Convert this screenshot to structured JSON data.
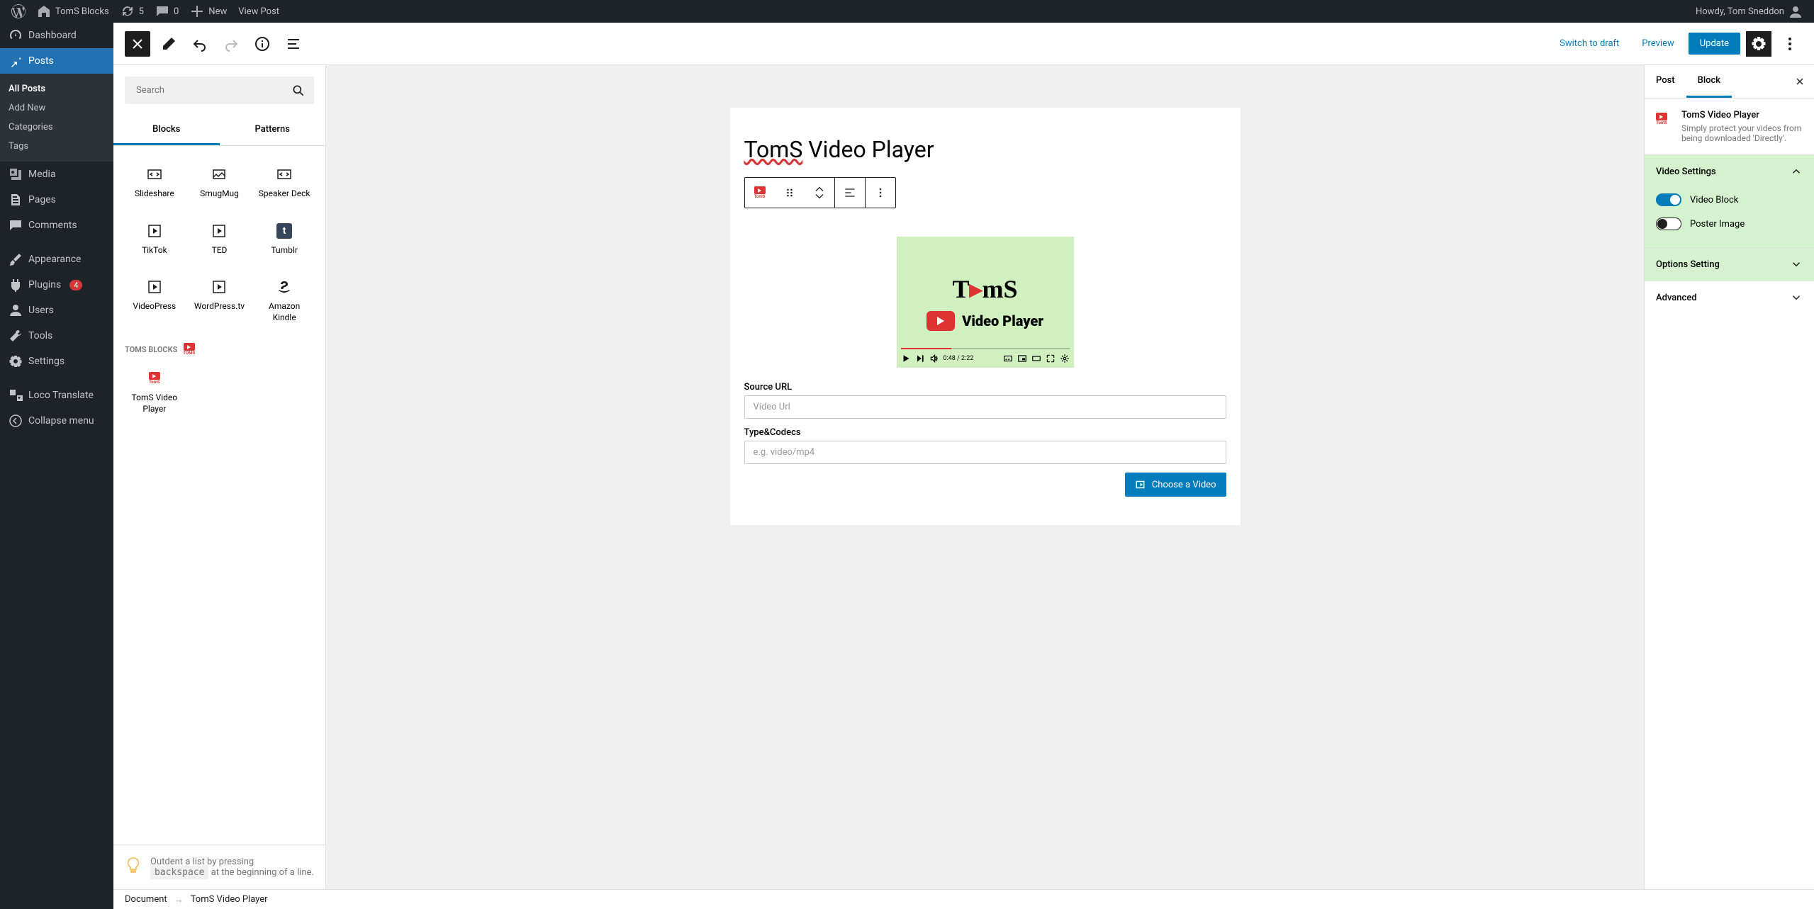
{
  "adminbar": {
    "site_name": "TomS Blocks",
    "refresh_count": "5",
    "comment_count": "0",
    "new_label": "New",
    "view_post": "View Post",
    "howdy": "Howdy, Tom Sneddon"
  },
  "sidebar": {
    "items": [
      {
        "label": "Dashboard",
        "icon": "dashboard"
      },
      {
        "label": "Posts",
        "icon": "pin",
        "active": true,
        "submenu": [
          "All Posts",
          "Add New",
          "Categories",
          "Tags"
        ],
        "submenu_current": 0
      },
      {
        "label": "Media",
        "icon": "media"
      },
      {
        "label": "Pages",
        "icon": "pages"
      },
      {
        "label": "Comments",
        "icon": "comment"
      },
      {
        "label": "Appearance",
        "icon": "brush"
      },
      {
        "label": "Plugins",
        "icon": "plugin",
        "badge": "4"
      },
      {
        "label": "Users",
        "icon": "user"
      },
      {
        "label": "Tools",
        "icon": "wrench"
      },
      {
        "label": "Settings",
        "icon": "settings"
      },
      {
        "label": "Loco Translate",
        "icon": "translate"
      },
      {
        "label": "Collapse menu",
        "icon": "collapse"
      }
    ]
  },
  "editor_header": {
    "switch_to_draft": "Switch to draft",
    "preview": "Preview",
    "update": "Update"
  },
  "inserter": {
    "search_placeholder": "Search",
    "tabs": [
      "Blocks",
      "Patterns"
    ],
    "active_tab": 0,
    "blocks": [
      {
        "label": "Slideshare",
        "icon": "embed"
      },
      {
        "label": "SmugMug",
        "icon": "image"
      },
      {
        "label": "Speaker Deck",
        "icon": "embed"
      },
      {
        "label": "TikTok",
        "icon": "play-square"
      },
      {
        "label": "TED",
        "icon": "play-square"
      },
      {
        "label": "Tumblr",
        "icon": "tumblr"
      },
      {
        "label": "VideoPress",
        "icon": "play-square"
      },
      {
        "label": "WordPress.tv",
        "icon": "play-square"
      },
      {
        "label": "Amazon Kindle",
        "icon": "amazon"
      }
    ],
    "category": "TOMS BLOCKS",
    "custom_block": "TomS Video Player",
    "tip_pre": "Outdent a list by pressing",
    "tip_kbd": "backspace",
    "tip_post": "at the beginning of a line."
  },
  "canvas": {
    "post_title_underlined": "TomS",
    "post_title_rest": " Video Player",
    "video_logo_text": "TomS",
    "video_label_text": "Video Player",
    "video_time": "0:48 / 2:22",
    "source_url_label": "Source URL",
    "source_url_placeholder": "Video Url",
    "type_codecs_label": "Type&Codecs",
    "type_codecs_placeholder": "e.g. video/mp4",
    "choose_video": "Choose a Video"
  },
  "breadcrumb": {
    "document": "Document",
    "current": "TomS Video Player"
  },
  "inspector": {
    "tabs": [
      "Post",
      "Block"
    ],
    "active_tab": 1,
    "block_title": "TomS Video Player",
    "block_desc": "Simply protect your videos from being downloaded 'Directly'.",
    "panels": {
      "video_settings": {
        "title": "Video Settings",
        "toggle_block": "Video Block",
        "toggle_poster": "Poster Image"
      },
      "options_setting": "Options Setting",
      "advanced": "Advanced"
    }
  }
}
